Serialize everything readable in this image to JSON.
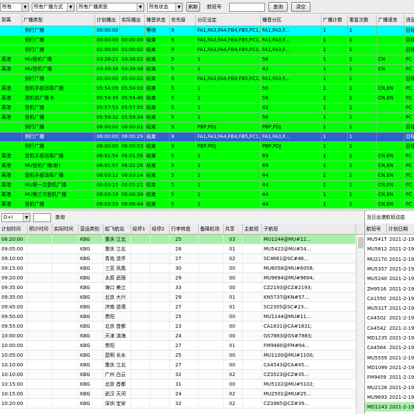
{
  "toolbar": {
    "filter_all_1": "所有",
    "filter_broadcast_mode": "所有广播方式",
    "filter_broadcast_type": "所有广播类型",
    "filter_status": "所有状态",
    "refresh_label": "刷新",
    "flight_no_label": "航班号",
    "flight_no_value": "",
    "query_label": "查询",
    "clear_label": "清空"
  },
  "broadcast_grid": {
    "columns": [
      "到离",
      "广播类型",
      "计划播出",
      "实际播出",
      "播音状态",
      "优先级",
      "分区设定",
      "播音分区",
      "广播计数",
      "重复次数",
      "广播语言",
      "消息"
    ],
    "rows": [
      {
        "dir": "",
        "type": "例行广播",
        "plan": "00:00:00",
        "actual": "",
        "status": "等待",
        "prio": "9",
        "zones": "FA1,FA3,FA4,FB4,FB5,FC1,FC3,FC4...",
        "play_zone": "FA1,FA3,F...",
        "count": "1",
        "repeat": "1",
        "lang": "",
        "msg": "目标",
        "color": "#00ffff"
      },
      {
        "dir": "",
        "type": "例行广播",
        "plan": "00:00:00",
        "actual": "00:00:00",
        "status": "结束",
        "prio": "9",
        "zones": "FA1,FA3,FA4,FB4,FB5,FC1,FC3,FC4...",
        "play_zone": "FA1,FA3,F...",
        "count": "1",
        "repeat": "1",
        "lang": "",
        "msg": "目标",
        "color": "#00ff00"
      },
      {
        "dir": "",
        "type": "例行广播",
        "plan": "01:00:00",
        "actual": "01:00:02",
        "status": "结束",
        "prio": "9",
        "zones": "FA1,FA3,FA4,FB4,FB5,FC1,FC3,FC4...",
        "play_zone": "FA1,FA3,F...",
        "count": "1",
        "repeat": "1",
        "lang": "",
        "msg": "目标",
        "color": "#00ff00"
      },
      {
        "dir": "离港",
        "type": "MU登机广播",
        "plan": "03:28:21",
        "actual": "03:28:22",
        "status": "结束",
        "prio": "5",
        "zones": "1",
        "play_zone": "56",
        "count": "1",
        "repeat": "1",
        "lang": "CN",
        "msg": "PC",
        "color": "#00ff00"
      },
      {
        "dir": "离港",
        "type": "MU登机广播",
        "plan": "03:39:38",
        "actual": "03:39:38",
        "status": "结束",
        "prio": "5",
        "zones": "1",
        "play_zone": "42",
        "count": "1",
        "repeat": "1",
        "lang": "CN",
        "msg": "PC",
        "color": "#00ff00"
      },
      {
        "dir": "",
        "type": "例行广播",
        "plan": "05:00:00",
        "actual": "05:00:02",
        "status": "结束",
        "prio": "9",
        "zones": "FA1,FA3,FA4,FB4,FB5,FC1,FC3,FC4...",
        "play_zone": "FA1,FA3,F...",
        "count": "1",
        "repeat": "1",
        "lang": "",
        "msg": "目标",
        "color": "#00ff00"
      },
      {
        "dir": "离港",
        "type": "登机手部消毒广播",
        "plan": "05:54:09",
        "actual": "05:54:10",
        "status": "结束",
        "prio": "5",
        "zones": "1",
        "play_zone": "56",
        "count": "1",
        "repeat": "1",
        "lang": "CN,EN",
        "msg": "PC",
        "color": "#00ff00"
      },
      {
        "dir": "离港",
        "type": "登机前广播 B",
        "plan": "05:54:39",
        "actual": "05:54:40",
        "status": "结束",
        "prio": "5",
        "zones": "1",
        "play_zone": "56",
        "count": "1",
        "repeat": "1",
        "lang": "CN,EN",
        "msg": "PC",
        "color": "#00ff00"
      },
      {
        "dir": "离港",
        "type": "登机广播",
        "plan": "05:57:53",
        "actual": "05:57:55",
        "status": "结束",
        "prio": "5",
        "zones": "1",
        "play_zone": "42",
        "count": "1",
        "repeat": "1",
        "lang": "",
        "msg": "PC",
        "color": "#00ff00"
      },
      {
        "dir": "离港",
        "type": "登机广播",
        "plan": "05:59:32",
        "actual": "05:59:34",
        "status": "结束",
        "prio": "5",
        "zones": "1",
        "play_zone": "56",
        "count": "1",
        "repeat": "1",
        "lang": "",
        "msg": "PC",
        "color": "#00ff00"
      },
      {
        "dir": "",
        "type": "例行广播",
        "plan": "06:00:00",
        "actual": "06:00:01",
        "status": "结束",
        "prio": "9",
        "zones": "PBP,PDJ",
        "play_zone": "PBP,PDJ",
        "count": "1",
        "repeat": "1",
        "lang": "",
        "msg": "目标",
        "color": "#00ff00"
      },
      {
        "dir": "",
        "type": "例行广播",
        "plan": "06:00:00",
        "actual": "06:00:29",
        "status": "结束",
        "prio": "9",
        "zones": "FA1,FA3,FA4,FB4,FB5,FC1,FC3,FC4...",
        "play_zone": "FA1,FA3,F...",
        "count": "1",
        "repeat": "1",
        "lang": "",
        "msg": "目标",
        "color": "#2f63c9",
        "selected": true
      },
      {
        "dir": "",
        "type": "例行广播",
        "plan": "06:00:00",
        "actual": "06:00:53",
        "status": "结束",
        "prio": "9",
        "zones": "PBP,PDJ",
        "play_zone": "PBP,PDJ",
        "count": "1",
        "repeat": "1",
        "lang": "",
        "msg": "目标",
        "color": "#00ff00"
      },
      {
        "dir": "离港",
        "type": "登机手部消毒广播",
        "plan": "06:01:54",
        "actual": "06:01:56",
        "status": "结束",
        "prio": "5",
        "zones": "1",
        "play_zone": "69",
        "count": "1",
        "repeat": "1",
        "lang": "CN,EN",
        "msg": "PC",
        "color": "#00ff00"
      },
      {
        "dir": "离港",
        "type": "MU登机广播(新)",
        "plan": "06:01:57",
        "actual": "06:02:26",
        "status": "结束",
        "prio": "5",
        "zones": "1",
        "play_zone": "69",
        "count": "1",
        "repeat": "1",
        "lang": "CN,EN",
        "msg": "PC",
        "color": "#00ff00"
      },
      {
        "dir": "离港",
        "type": "登机手部消毒广播",
        "plan": "06:03:12",
        "actual": "06:03:14",
        "status": "结束",
        "prio": "5",
        "zones": "1",
        "play_zone": "44",
        "count": "1",
        "repeat": "1",
        "lang": "CN,EN",
        "msg": "PC",
        "color": "#00ff00"
      },
      {
        "dir": "离港",
        "type": "MU第一次登机广播",
        "plan": "06:03:15",
        "actual": "06:05:21",
        "status": "结束",
        "prio": "5",
        "zones": "1",
        "play_zone": "44",
        "count": "1",
        "repeat": "1",
        "lang": "CN,EN",
        "msg": "PC",
        "color": "#00ff00"
      },
      {
        "dir": "离港",
        "type": "MU第三次登机广播",
        "plan": "06:03:18",
        "actual": "06:06:39",
        "status": "结束",
        "prio": "5",
        "zones": "1",
        "play_zone": "44",
        "count": "1",
        "repeat": "1",
        "lang": "CN,EN",
        "msg": "PC",
        "color": "#00ff00"
      },
      {
        "dir": "离港",
        "type": "登机广播",
        "plan": "06:03:20",
        "actual": "06:06:44",
        "status": "结束",
        "prio": "5",
        "zones": "1",
        "play_zone": "44",
        "count": "1",
        "repeat": "1",
        "lang": "CN,EN",
        "msg": "PC",
        "color": "#00ff00"
      }
    ]
  },
  "flight_filter": {
    "dir_value": "D+I",
    "input_value": "",
    "query_label": "查询"
  },
  "flight_grid": {
    "columns": [
      "计划时间",
      "预计时间",
      "实际时间",
      "营运类别",
      "起飞航站",
      "经停1",
      "经停2",
      "行李转盘",
      "备降机场",
      "共享",
      "主航班",
      "子航班"
    ],
    "rows": [
      {
        "plan": "08:20:00",
        "est": "",
        "act": "",
        "cat": "KBG",
        "route": "重庆 江北",
        "s1": "",
        "s2": "",
        "belt": "25",
        "alt": "",
        "share": "03",
        "main": "",
        "sub": "MU1244@MU#12...",
        "hl": true
      },
      {
        "plan": "09:05:00",
        "est": "",
        "act": "",
        "cat": "KBG",
        "route": "重庆 江北",
        "s1": "",
        "s2": "",
        "belt": "28",
        "alt": "",
        "share": "01",
        "main": "",
        "sub": "MU5422@MU#54...",
        "hl": false
      },
      {
        "plan": "09:10:00",
        "est": "",
        "act": "",
        "cat": "KBG",
        "route": "青岛 流亭",
        "s1": "",
        "s2": "",
        "belt": "27",
        "alt": "",
        "share": "02",
        "main": "",
        "sub": "SC4661@SC#46...",
        "hl": false
      },
      {
        "plan": "09:15:00",
        "est": "",
        "act": "",
        "cat": "KBG",
        "route": "三亚 凤凰",
        "s1": "",
        "s2": "",
        "belt": "30",
        "alt": "",
        "share": "00",
        "main": "",
        "sub": "MU6058@MU#6058;",
        "hl": false
      },
      {
        "plan": "09:20:00",
        "est": "",
        "act": "",
        "cat": "KBG",
        "route": "太原 武宿",
        "s1": "",
        "s2": "",
        "belt": "29",
        "alt": "",
        "share": "00",
        "main": "",
        "sub": "MU9694@MU#9694;",
        "hl": false
      },
      {
        "plan": "09:35:00",
        "est": "",
        "act": "",
        "cat": "KBG",
        "route": "海口 美兰",
        "s1": "",
        "s2": "",
        "belt": "33",
        "alt": "",
        "share": "00",
        "main": "",
        "sub": "CZ2193@CZ#2193;",
        "hl": false
      },
      {
        "plan": "09:35:00",
        "est": "",
        "act": "",
        "cat": "KBG",
        "route": "北京 大兴",
        "s1": "",
        "s2": "",
        "belt": "29",
        "alt": "",
        "share": "01",
        "main": "",
        "sub": "KN5737@KN#57...",
        "hl": false
      },
      {
        "plan": "09:45:00",
        "est": "",
        "act": "",
        "cat": "KBG",
        "route": "济南 遥墙",
        "s1": "",
        "s2": "",
        "belt": "27",
        "alt": "",
        "share": "01",
        "main": "",
        "sub": "SC2305@SC#23...",
        "hl": false
      },
      {
        "plan": "09:50:00",
        "est": "",
        "act": "",
        "cat": "KBG",
        "route": "贵阳",
        "s1": "",
        "s2": "",
        "belt": "25",
        "alt": "",
        "share": "00",
        "main": "",
        "sub": "MU1144@MU#11...",
        "hl": false
      },
      {
        "plan": "09:55:00",
        "est": "",
        "act": "",
        "cat": "KBG",
        "route": "北京 首都",
        "s1": "",
        "s2": "",
        "belt": "23",
        "alt": "",
        "share": "00",
        "main": "",
        "sub": "CA1831@CA#1831;",
        "hl": false
      },
      {
        "plan": "10:00:00",
        "est": "",
        "act": "",
        "cat": "KBG",
        "route": "天津 滨海",
        "s1": "",
        "s2": "",
        "belt": "24",
        "alt": "",
        "share": "00",
        "main": "",
        "sub": "GS7883@GS#7883;",
        "hl": false
      },
      {
        "plan": "10:00:00",
        "est": "",
        "act": "",
        "cat": "KBG",
        "route": "贵阳",
        "s1": "",
        "s2": "",
        "belt": "27",
        "alt": "",
        "share": "01",
        "main": "",
        "sub": "FM9460@FM#94...",
        "hl": false
      },
      {
        "plan": "10:05:00",
        "est": "",
        "act": "",
        "cat": "KBG",
        "route": "昆明 长水",
        "s1": "",
        "s2": "",
        "belt": "25",
        "alt": "",
        "share": "00",
        "main": "",
        "sub": "MU1100@MU#1100;",
        "hl": false
      },
      {
        "plan": "10:10:00",
        "est": "",
        "act": "",
        "cat": "KBG",
        "route": "重庆 江北",
        "s1": "",
        "s2": "",
        "belt": "27",
        "alt": "",
        "share": "00",
        "main": "",
        "sub": "CA4543@CA#45...",
        "hl": false
      },
      {
        "plan": "10:10:00",
        "est": "",
        "act": "",
        "cat": "KBG",
        "route": "广州 白云",
        "s1": "",
        "s2": "",
        "belt": "32",
        "alt": "",
        "share": "02",
        "main": "",
        "sub": "CZ3523@CZ#35...",
        "hl": false
      },
      {
        "plan": "10:15:00",
        "est": "",
        "act": "",
        "cat": "KBG",
        "route": "北京 首都",
        "s1": "",
        "s2": "",
        "belt": "31",
        "alt": "",
        "share": "00",
        "main": "",
        "sub": "MU5102@MU#5102;",
        "hl": false
      },
      {
        "plan": "10:15:00",
        "est": "",
        "act": "",
        "cat": "KBG",
        "route": "武汉 天河",
        "s1": "",
        "s2": "",
        "belt": "24",
        "alt": "",
        "share": "02",
        "main": "",
        "sub": "MU2501@MU#25...",
        "hl": false
      },
      {
        "plan": "10:20:00",
        "est": "",
        "act": "",
        "cat": "KBG",
        "route": "深圳 宝安",
        "s1": "",
        "s2": "",
        "belt": "32",
        "alt": "",
        "share": "02",
        "main": "",
        "sub": "CZ3965@CZ#39...",
        "hl": false
      }
    ]
  },
  "side_panel": {
    "title": "当日出港航班动态",
    "columns": [
      "航班号",
      "计划日期"
    ],
    "rows": [
      {
        "flight": "MU541T",
        "date": "2021-2-19",
        "hl": false
      },
      {
        "flight": "MU5812",
        "date": "2021-2-19",
        "hl": false
      },
      {
        "flight": "MU2170",
        "date": "2021-2-19",
        "hl": false
      },
      {
        "flight": "MU5357",
        "date": "2021-2-19",
        "hl": false
      },
      {
        "flight": "MU5240T",
        "date": "2021-2-19",
        "hl": false
      },
      {
        "flight": "ZH9516",
        "date": "2021-2-19",
        "hl": false
      },
      {
        "flight": "CA1550",
        "date": "2021-2-19",
        "hl": false
      },
      {
        "flight": "MU531T",
        "date": "2021-2-19",
        "hl": false
      },
      {
        "flight": "CA4502",
        "date": "2021-2-19",
        "hl": false
      },
      {
        "flight": "CA4542",
        "date": "2021-2-19",
        "hl": false
      },
      {
        "flight": "MD1235",
        "date": "2021-2-19",
        "hl": false
      },
      {
        "flight": "CA4564",
        "date": "2021-2-19",
        "hl": false
      },
      {
        "flight": "MU5559",
        "date": "2021-2-19",
        "hl": false
      },
      {
        "flight": "MD1099",
        "date": "2021-2-19",
        "hl": false
      },
      {
        "flight": "FM9459",
        "date": "2021-2-19",
        "hl": false
      },
      {
        "flight": "MU2128",
        "date": "2021-2-19",
        "hl": false
      },
      {
        "flight": "MU9693",
        "date": "2021-2-19",
        "hl": false
      },
      {
        "flight": "MD1243",
        "date": "2021-2-19",
        "hl": true
      }
    ]
  },
  "colors": {
    "row_green": "#00ff00",
    "row_cyan": "#00ffff",
    "row_selected": "#2f63c9",
    "row_highlight_light": "#a8f0a8"
  }
}
